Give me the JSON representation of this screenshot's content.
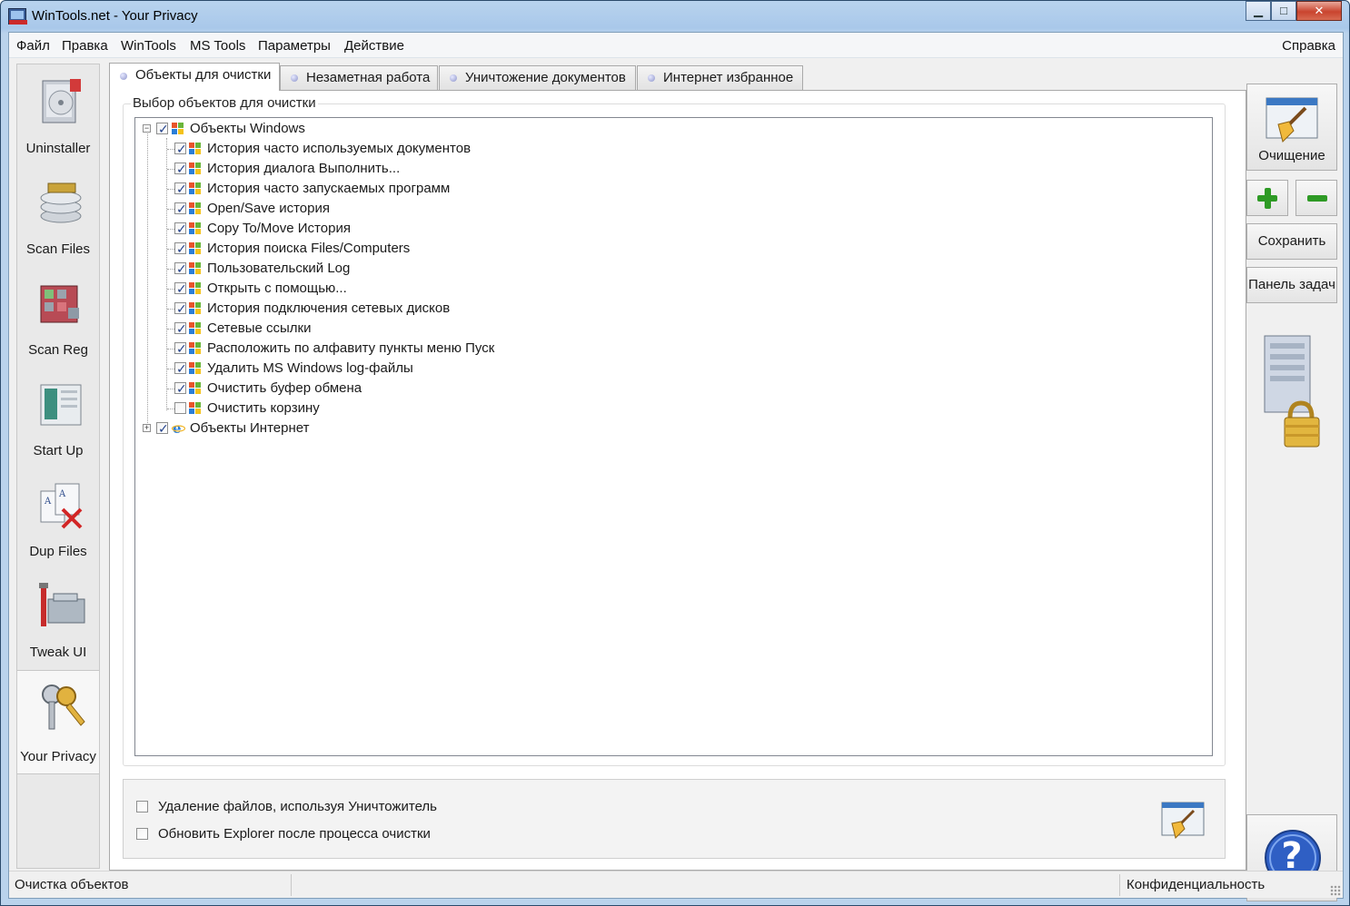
{
  "window": {
    "title": "WinTools.net - Your Privacy",
    "controls": {
      "minimize": "▁",
      "maximize": "□",
      "close": "✕"
    }
  },
  "menu": {
    "left": [
      "Файл",
      "Правка",
      "WinTools",
      "MS Tools",
      "Параметры",
      "Действие"
    ],
    "right": "Справка"
  },
  "sidebar": {
    "items": [
      {
        "label": "Uninstaller",
        "icon": "uninstaller-icon"
      },
      {
        "label": "Scan Files",
        "icon": "scan-files-icon"
      },
      {
        "label": "Scan Reg",
        "icon": "scan-reg-icon"
      },
      {
        "label": "Start Up",
        "icon": "startup-icon"
      },
      {
        "label": "Dup Files",
        "icon": "dup-files-icon"
      },
      {
        "label": "Tweak UI",
        "icon": "tweak-ui-icon"
      },
      {
        "label": "Your Privacy",
        "icon": "keys-icon",
        "active": true
      }
    ]
  },
  "tabs": [
    {
      "label": "Объекты для очистки",
      "active": true
    },
    {
      "label": "Незаметная работа",
      "active": false
    },
    {
      "label": "Уничтожение документов",
      "active": false
    },
    {
      "label": "Интернет избранное",
      "active": false
    }
  ],
  "group": {
    "legend": "Выбор объектов для очистки"
  },
  "tree": {
    "windows": {
      "label": "Объекты Windows",
      "checked": true,
      "expanded": true,
      "children": [
        {
          "label": "История часто используемых документов",
          "checked": true
        },
        {
          "label": "История диалога Выполнить...",
          "checked": true
        },
        {
          "label": "История часто запускаемых программ",
          "checked": true
        },
        {
          "label": "Open/Save история",
          "checked": true
        },
        {
          "label": "Copy To/Move История",
          "checked": true
        },
        {
          "label": "История поиска Files/Computers",
          "checked": true
        },
        {
          "label": "Пользовательский Log",
          "checked": true
        },
        {
          "label": "Открыть с помощью...",
          "checked": true
        },
        {
          "label": "История подключения сетевых дисков",
          "checked": true
        },
        {
          "label": "Сетевые ссылки",
          "checked": true
        },
        {
          "label": "Расположить по алфавиту пункты меню Пуск",
          "checked": true
        },
        {
          "label": "Удалить MS Windows log-файлы",
          "checked": true
        },
        {
          "label": "Очистить буфер обмена",
          "checked": true
        },
        {
          "label": "Очистить корзину",
          "checked": false
        }
      ]
    },
    "internet": {
      "label": "Объекты Интернет",
      "checked": true,
      "expanded": false
    }
  },
  "options": [
    {
      "label": "Удаление файлов, используя Уничтожитель",
      "checked": false
    },
    {
      "label": "Обновить Explorer после процесса очистки",
      "checked": false
    }
  ],
  "right": {
    "clean_label": "Очищение",
    "save_label": "Сохранить",
    "taskbar_label": "Панель задач",
    "help_glyph": "?"
  },
  "status": {
    "left": "Очистка объектов",
    "right": "Конфиденциальность"
  },
  "colors": {
    "title_bar": "#a9c8ea",
    "close_button": "#c9442e",
    "accent_blue": "#23428c",
    "green_action": "#2e9a25"
  }
}
